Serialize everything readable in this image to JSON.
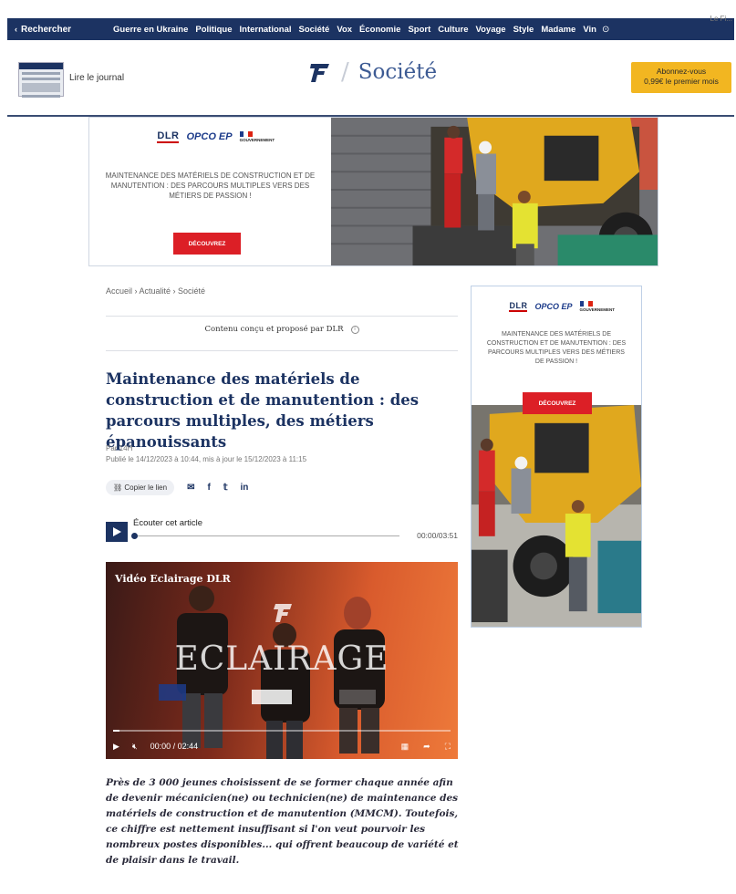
{
  "nav": {
    "search_label": "Rechercher",
    "links": [
      "Guerre en Ukraine",
      "Politique",
      "International",
      "Société",
      "Vox",
      "Économie",
      "Sport",
      "Culture",
      "Voyage",
      "Style",
      "Madame",
      "Vin"
    ],
    "corner_text": "Le Fi..."
  },
  "header": {
    "read_journal": "Lire le journal",
    "section": "Société",
    "subscribe_line1": "Abonnez-vous",
    "subscribe_line2": "0,99€ le premier mois"
  },
  "ad": {
    "brand_dlr": "DLR",
    "brand_pco": "OPCO EP",
    "brand_gov": "GOUVERNEMENT",
    "tagline": "MAINTENANCE DES MATÉRIELS DE CONSTRUCTION ET DE MANUTENTION : DES PARCOURS MULTIPLES VERS DES MÉTIERS DE PASSION !",
    "cta": "DÉCOUVREZ"
  },
  "breadcrumb": "Accueil › Actualité › Société",
  "sponsor": "Contenu conçu et proposé par DLR",
  "article": {
    "title": "Maintenance des matériels de construction et de manutention : des parcours multiples, des métiers épanouissants",
    "author": "Par 14H",
    "published": "Publié le 14/12/2023 à 10:44, mis à jour le 15/12/2023 à 11:15",
    "lede": "Près de 3 000 jeunes choisissent de se former chaque année afin de devenir mécanicien(ne) ou technicien(ne) de maintenance des matériels de construction et de manutention (MMCM). Toutefois, ce chiffre est nettement insuffisant si l'on veut pourvoir les nombreux postes disponibles... qui offrent beaucoup de variété et de plaisir dans le travail."
  },
  "share": {
    "copy_label": "Copier le lien",
    "icons": [
      "mail-icon",
      "facebook-icon",
      "twitter-icon",
      "linkedin-icon"
    ]
  },
  "audio": {
    "label": "Écouter cet article",
    "time": "00:00/03:51",
    "progress": 0
  },
  "video": {
    "title": "Vidéo Eclairage DLR",
    "overlay_word": "ECLAIRAGE",
    "time": "00:00 / 02:44",
    "progress": 0.02
  }
}
